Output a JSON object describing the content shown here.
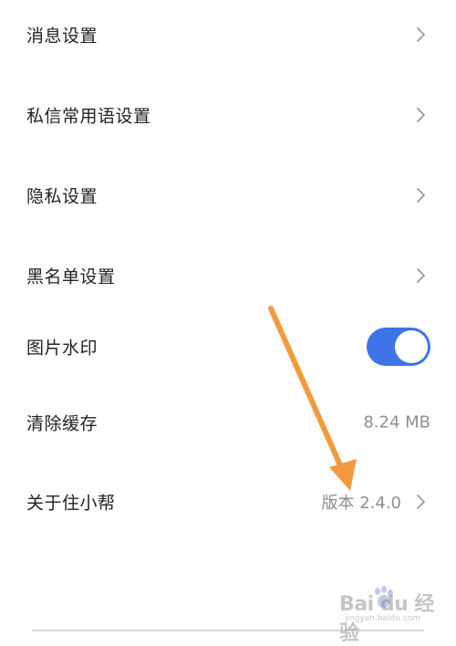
{
  "settings": {
    "items": [
      {
        "label": "消息设置",
        "value": "",
        "control": "chevron"
      },
      {
        "label": "私信常用语设置",
        "value": "",
        "control": "chevron"
      },
      {
        "label": "隐私设置",
        "value": "",
        "control": "chevron"
      },
      {
        "label": "黑名单设置",
        "value": "",
        "control": "chevron"
      },
      {
        "label": "图片水印",
        "value": "",
        "control": "toggle",
        "toggle_on": true
      },
      {
        "label": "清除缓存",
        "value": "8.24 MB",
        "control": "none"
      },
      {
        "label": "关于住小帮",
        "value": "版本 2.4.0",
        "control": "chevron"
      }
    ]
  },
  "watermark": {
    "brand": "Bai du 经验",
    "url": "jingyan.baidu.com"
  },
  "colors": {
    "toggle_on": "#3f73e8",
    "arrow": "#f39a3e",
    "label_text": "#222222",
    "value_text": "#8f8f8f",
    "chevron": "#9a9a9a"
  },
  "icons": {
    "chevron": "chevron-right-icon",
    "annotation": "orange-arrow-annotation"
  }
}
